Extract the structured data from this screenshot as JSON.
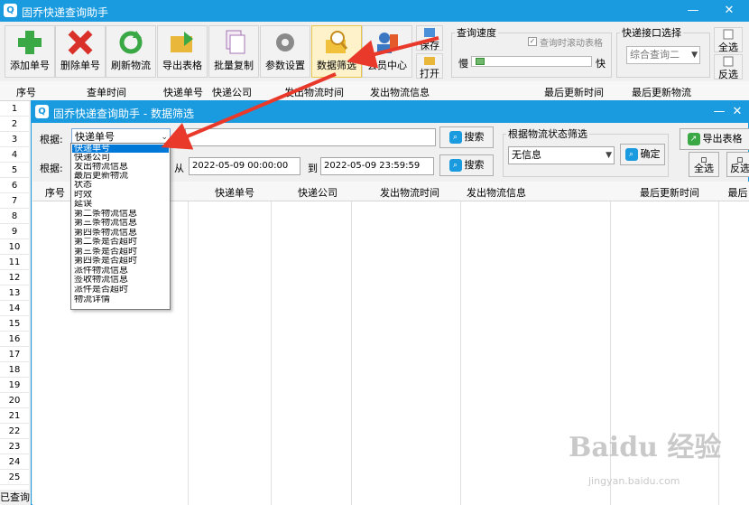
{
  "main": {
    "title": "固乔快递查询助手",
    "toolbar": [
      {
        "label": "添加单号",
        "icon": "plus-icon"
      },
      {
        "label": "删除单号",
        "icon": "delete-x-icon"
      },
      {
        "label": "刷新物流",
        "icon": "refresh-icon"
      },
      {
        "label": "导出表格",
        "icon": "export-folder-icon"
      },
      {
        "label": "批量复制",
        "icon": "copy-pages-icon"
      },
      {
        "label": "参数设置",
        "icon": "gear-icon"
      },
      {
        "label": "数据筛选",
        "icon": "filter-search-icon"
      },
      {
        "label": "会员中心",
        "icon": "member-icon"
      }
    ],
    "save_label": "保存",
    "open_label": "打开",
    "speed_group": {
      "title": "查询速度",
      "auto_scroll": "查询时滚动表格",
      "slow": "慢",
      "fast": "快"
    },
    "api_group": {
      "title": "快递接口选择",
      "selected": "综合查询二"
    },
    "select_all": "全选",
    "invert": "反选",
    "columns": [
      "序号",
      "查单时间",
      "快递单号",
      "快递公司",
      "发出物流时间",
      "发出物流信息",
      "最后更新时间",
      "最后更新物流"
    ],
    "row_numbers": [
      "1",
      "2",
      "3",
      "4",
      "5",
      "6",
      "7",
      "8",
      "9",
      "10",
      "11",
      "12",
      "13",
      "14",
      "15",
      "16",
      "17",
      "18",
      "19",
      "20",
      "21",
      "22",
      "23",
      "24",
      "25"
    ],
    "status": "已查询"
  },
  "dialog": {
    "title": "固乔快递查询助手 - 数据筛选",
    "by_label": "根据:",
    "by_selected": "快递单号",
    "search_label": "搜索",
    "by_label2": "根据:",
    "from_label": "从",
    "to_label": "到",
    "from_date": "2022-05-09 00:00:00",
    "to_date": "2022-05-09 23:59:59",
    "status_group": {
      "title": "根据物流状态筛选",
      "selected": "无信息",
      "confirm": "确定"
    },
    "export_label": "导出表格",
    "select_all": "全选",
    "invert": "反选",
    "columns": [
      "序号",
      "快递单号",
      "快递公司",
      "发出物流时间",
      "发出物流信息",
      "最后更新时间",
      "最后更"
    ],
    "dropdown_options": [
      "快递单号",
      "快递公司",
      "发出物流信息",
      "最后更新物流",
      "状态",
      "时效",
      "延误",
      "第二条物流信息",
      "第三条物流信息",
      "第四条物流信息",
      "第二条是否超时",
      "第三条是否超时",
      "第四条是否超时",
      "派件物流信息",
      "签收物流信息",
      "派件是否超时",
      "物流详情"
    ]
  },
  "watermark": {
    "brand": "Baidu 经验",
    "url": "jingyan.baidu.com"
  },
  "colors": {
    "titlebar": "#1a9be0",
    "arrow": "#e8392a",
    "selection": "#0078d7"
  }
}
